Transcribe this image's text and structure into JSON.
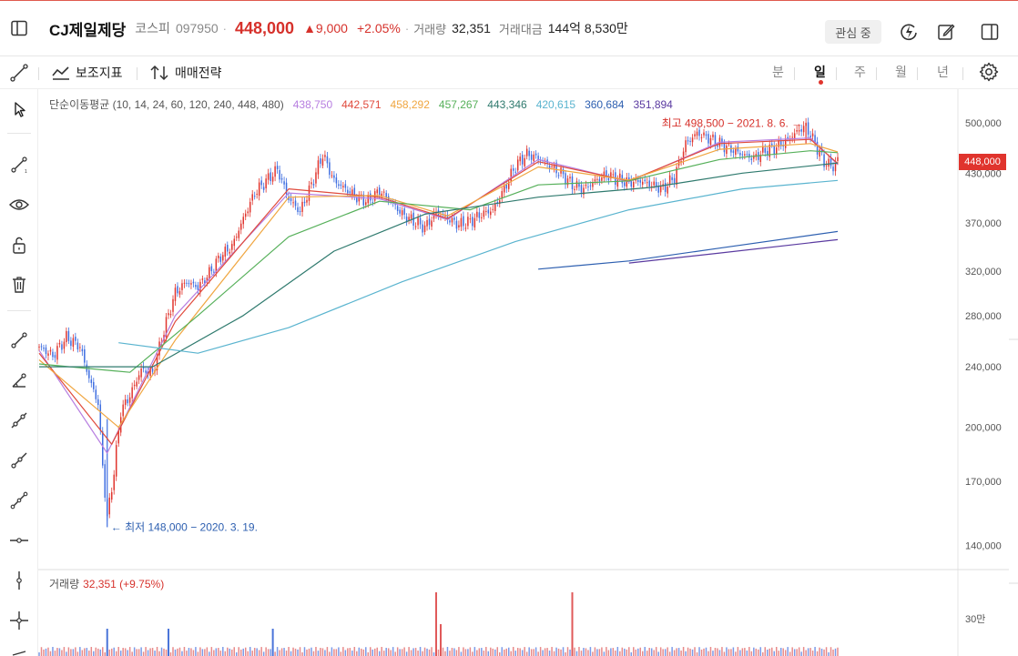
{
  "header": {
    "name": "CJ제일제당",
    "market": "코스피",
    "code": "097950",
    "sep": "·",
    "price": "448,000",
    "change": "▲9,000",
    "rate": "+2.05%",
    "volume_label": "거래량",
    "volume": "32,351",
    "amount_label": "거래대금",
    "amount": "144억 8,530만",
    "watch_label": "관심 중"
  },
  "toolbar": {
    "indicators_label": "보조지표",
    "strategy_label": "매매전략",
    "periods": [
      "분",
      "일",
      "주",
      "월",
      "년"
    ],
    "active_period": "일"
  },
  "ma_legend": {
    "title": "단순이동평균 (10, 14, 24, 60, 120, 240, 448, 480)",
    "values": [
      {
        "value": "438,750",
        "color": "#b77ee0"
      },
      {
        "value": "442,571",
        "color": "#e04a3c"
      },
      {
        "value": "458,292",
        "color": "#f0a640"
      },
      {
        "value": "457,267",
        "color": "#56b05a"
      },
      {
        "value": "443,346",
        "color": "#2f7a6e"
      },
      {
        "value": "420,615",
        "color": "#5ab4cf"
      },
      {
        "value": "360,684",
        "color": "#2d5fb0"
      },
      {
        "value": "351,894",
        "color": "#5a3aa0"
      }
    ]
  },
  "volume_legend": {
    "label": "거래량",
    "value": "32,351 (+9.75%)"
  },
  "current_price_tag": "448,000",
  "chart_data": {
    "type": "candlestick",
    "y_axis_scale": "log",
    "y_ticks": [
      500000,
      430000,
      370000,
      320000,
      280000,
      240000,
      200000,
      170000,
      140000
    ],
    "y_tick_labels": [
      "500,000",
      "430,000",
      "370,000",
      "320,000",
      "280,000",
      "240,000",
      "200,000",
      "170,000",
      "140,000"
    ],
    "volume_tick_labels": [
      "30만"
    ],
    "annotations": [
      {
        "label": "최고 498,500 − 2021. 8. 6.",
        "value": 498500,
        "color": "#d6312b"
      },
      {
        "label": "← 최저 148,000 − 2020. 3. 19.",
        "value": 148000,
        "color": "#2d5fb0"
      }
    ],
    "close_path": [
      [
        0,
        255000
      ],
      [
        6,
        248000
      ],
      [
        12,
        262000
      ],
      [
        18,
        255000
      ],
      [
        22,
        232000
      ],
      [
        26,
        215000
      ],
      [
        28,
        178000
      ],
      [
        30,
        152000
      ],
      [
        33,
        175000
      ],
      [
        36,
        210000
      ],
      [
        40,
        220000
      ],
      [
        45,
        238000
      ],
      [
        50,
        235000
      ],
      [
        55,
        268000
      ],
      [
        60,
        300000
      ],
      [
        65,
        310000
      ],
      [
        70,
        305000
      ],
      [
        75,
        318000
      ],
      [
        80,
        335000
      ],
      [
        85,
        345000
      ],
      [
        90,
        375000
      ],
      [
        95,
        405000
      ],
      [
        100,
        420000
      ],
      [
        105,
        435000
      ],
      [
        110,
        398000
      ],
      [
        115,
        383000
      ],
      [
        120,
        415000
      ],
      [
        125,
        455000
      ],
      [
        130,
        420000
      ],
      [
        135,
        410000
      ],
      [
        140,
        400000
      ],
      [
        145,
        395000
      ],
      [
        150,
        408000
      ],
      [
        155,
        395000
      ],
      [
        160,
        380000
      ],
      [
        165,
        372000
      ],
      [
        170,
        365000
      ],
      [
        175,
        382000
      ],
      [
        180,
        375000
      ],
      [
        185,
        368000
      ],
      [
        190,
        372000
      ],
      [
        195,
        380000
      ],
      [
        200,
        385000
      ],
      [
        205,
        410000
      ],
      [
        210,
        440000
      ],
      [
        215,
        455000
      ],
      [
        220,
        450000
      ],
      [
        225,
        440000
      ],
      [
        230,
        430000
      ],
      [
        235,
        415000
      ],
      [
        240,
        410000
      ],
      [
        245,
        420000
      ],
      [
        250,
        428000
      ],
      [
        255,
        422000
      ],
      [
        260,
        418000
      ],
      [
        265,
        420000
      ],
      [
        270,
        415000
      ],
      [
        275,
        410000
      ],
      [
        280,
        425000
      ],
      [
        285,
        470000
      ],
      [
        290,
        485000
      ],
      [
        295,
        478000
      ],
      [
        300,
        470000
      ],
      [
        305,
        462000
      ],
      [
        310,
        455000
      ],
      [
        315,
        450000
      ],
      [
        320,
        460000
      ],
      [
        325,
        465000
      ],
      [
        330,
        475000
      ],
      [
        335,
        490000
      ],
      [
        338,
        495000
      ],
      [
        342,
        470000
      ],
      [
        346,
        445000
      ],
      [
        350,
        438000
      ],
      [
        352,
        448000
      ]
    ],
    "ma_lines": [
      {
        "name": "MA10",
        "color": "#b77ee0",
        "points": [
          [
            0,
            252000
          ],
          [
            30,
            185000
          ],
          [
            60,
            280000
          ],
          [
            110,
            405000
          ],
          [
            150,
            398000
          ],
          [
            180,
            374000
          ],
          [
            220,
            448000
          ],
          [
            260,
            419000
          ],
          [
            300,
            472000
          ],
          [
            340,
            478000
          ],
          [
            352,
            441000
          ]
        ]
      },
      {
        "name": "MA14",
        "color": "#e04a3c",
        "points": [
          [
            0,
            250000
          ],
          [
            32,
            190000
          ],
          [
            60,
            275000
          ],
          [
            110,
            410000
          ],
          [
            150,
            400000
          ],
          [
            180,
            375000
          ],
          [
            220,
            445000
          ],
          [
            260,
            420000
          ],
          [
            300,
            470000
          ],
          [
            340,
            476000
          ],
          [
            352,
            442571
          ]
        ]
      },
      {
        "name": "MA24",
        "color": "#f0a640",
        "points": [
          [
            0,
            245000
          ],
          [
            35,
            200000
          ],
          [
            60,
            260000
          ],
          [
            110,
            400000
          ],
          [
            150,
            402000
          ],
          [
            180,
            378000
          ],
          [
            220,
            438000
          ],
          [
            260,
            421000
          ],
          [
            300,
            462000
          ],
          [
            340,
            470000
          ],
          [
            352,
            458292
          ]
        ]
      },
      {
        "name": "MA60",
        "color": "#56b05a",
        "points": [
          [
            0,
            242000
          ],
          [
            40,
            236000
          ],
          [
            70,
            280000
          ],
          [
            110,
            355000
          ],
          [
            150,
            395000
          ],
          [
            190,
            385000
          ],
          [
            220,
            415000
          ],
          [
            260,
            420000
          ],
          [
            300,
            448000
          ],
          [
            340,
            460000
          ],
          [
            352,
            457267
          ]
        ]
      },
      {
        "name": "MA120",
        "color": "#2f7a6e",
        "points": [
          [
            0,
            240000
          ],
          [
            50,
            240000
          ],
          [
            90,
            280000
          ],
          [
            130,
            340000
          ],
          [
            170,
            380000
          ],
          [
            220,
            400000
          ],
          [
            270,
            412000
          ],
          [
            310,
            430000
          ],
          [
            352,
            443346
          ]
        ]
      },
      {
        "name": "MA240",
        "color": "#5ab4cf",
        "points": [
          [
            35,
            258000
          ],
          [
            70,
            250000
          ],
          [
            110,
            270000
          ],
          [
            160,
            310000
          ],
          [
            210,
            350000
          ],
          [
            260,
            385000
          ],
          [
            310,
            410000
          ],
          [
            352,
            420615
          ]
        ]
      },
      {
        "name": "MA448",
        "color": "#2d5fb0",
        "points": [
          [
            220,
            322000
          ],
          [
            260,
            330000
          ],
          [
            300,
            343000
          ],
          [
            352,
            360684
          ]
        ]
      },
      {
        "name": "MA480",
        "color": "#5a3aa0",
        "points": [
          [
            260,
            328000
          ],
          [
            300,
            338000
          ],
          [
            352,
            351894
          ]
        ]
      }
    ],
    "volume_spikes": [
      {
        "i": 30,
        "color": "#4a74d9"
      },
      {
        "i": 57,
        "color": "#4a74d9"
      },
      {
        "i": 103,
        "color": "#4a74d9"
      },
      {
        "i": 175,
        "color": "#e0595a"
      },
      {
        "i": 177,
        "color": "#e0595a"
      },
      {
        "i": 235,
        "color": "#e0595a"
      }
    ]
  }
}
